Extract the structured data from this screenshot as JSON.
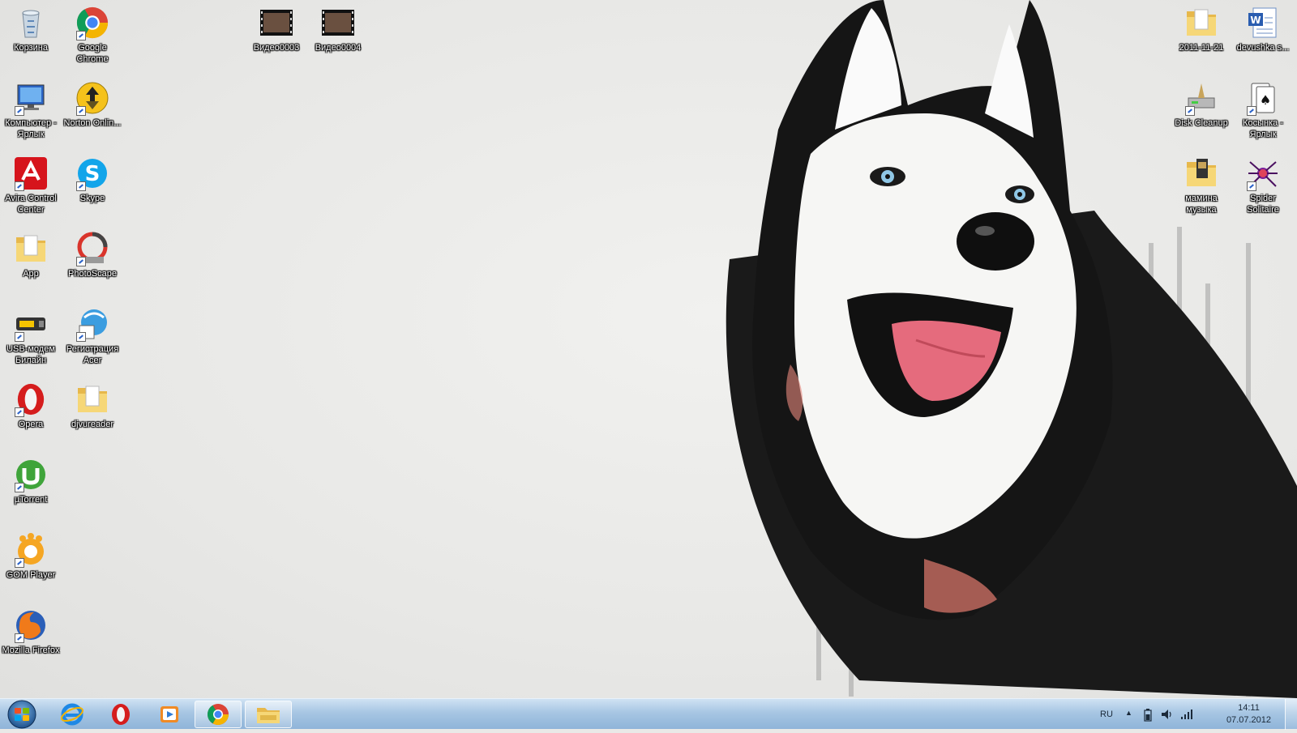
{
  "desktop": {
    "icons_left": [
      {
        "label": "Корзина",
        "icon": "recycle-bin-icon"
      },
      {
        "label": "Google Chrome",
        "icon": "chrome-icon"
      },
      {
        "label": "Компьютер - Ярлык",
        "icon": "computer-icon"
      },
      {
        "label": "Norton Onlin...",
        "icon": "norton-icon"
      },
      {
        "label": "Avira Control Center",
        "icon": "avira-icon"
      },
      {
        "label": "Skype",
        "icon": "skype-icon"
      },
      {
        "label": "App",
        "icon": "folder-icon"
      },
      {
        "label": "PhotoScape",
        "icon": "photoscape-icon"
      },
      {
        "label": "USB-модем Билайн",
        "icon": "usb-modem-icon"
      },
      {
        "label": "Регистрация Acer",
        "icon": "acer-registration-icon"
      },
      {
        "label": "Opera",
        "icon": "opera-icon"
      },
      {
        "label": "djvureader",
        "icon": "folder-icon"
      },
      {
        "label": "µTorrent",
        "icon": "utorrent-icon"
      },
      {
        "label": "GOM Player",
        "icon": "gom-player-icon"
      },
      {
        "label": "Mozilla Firefox",
        "icon": "firefox-icon"
      }
    ],
    "icons_top": [
      {
        "label": "Видео0003",
        "icon": "video-file-icon"
      },
      {
        "label": "Видео0004",
        "icon": "video-file-icon"
      }
    ],
    "icons_right": [
      {
        "label": "2011-11-21",
        "icon": "folder-icon"
      },
      {
        "label": "devushka s...",
        "icon": "word-document-icon"
      },
      {
        "label": "Disk Cleanup",
        "icon": "disk-cleanup-icon"
      },
      {
        "label": "Косынка - Ярлык",
        "icon": "solitaire-icon"
      },
      {
        "label": "мамина музыка",
        "icon": "music-folder-icon"
      },
      {
        "label": "Spider Solitaire",
        "icon": "spider-solitaire-icon"
      }
    ]
  },
  "taskbar": {
    "pinned": [
      {
        "name": "internet-explorer",
        "icon": "internet-explorer-icon"
      },
      {
        "name": "opera",
        "icon": "opera-icon"
      },
      {
        "name": "media-player",
        "icon": "media-player-icon"
      },
      {
        "name": "chrome",
        "icon": "chrome-icon"
      },
      {
        "name": "explorer",
        "icon": "folder-icon"
      }
    ],
    "language": "RU",
    "clock_time": "14:11",
    "clock_date": "07.07.2012"
  },
  "colors": {
    "taskbar_top": "#cfe2f3",
    "taskbar_bottom": "#8fb4d9",
    "desktop_bg": "#e9e9e7"
  }
}
